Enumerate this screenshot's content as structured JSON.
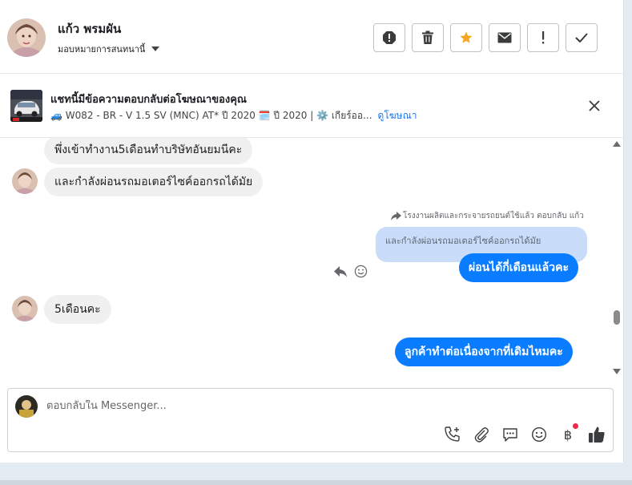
{
  "header": {
    "name": "แก้ว พรมผัน",
    "assign_label": "มอบหมายการสนทนานี้",
    "actions": [
      "spam-icon",
      "trash-icon",
      "star-icon",
      "mail-icon",
      "important-icon",
      "check-icon"
    ],
    "accent": "#f5a623"
  },
  "ad": {
    "title": "แชทนี้มีข้อความตอบกลับต่อโฆษณาของคุณ",
    "subtitle": "🚙 W082 - BR - V 1.5 SV (MNC) AT* ปี 2020 🗓️ ปี 2020 | ⚙️ เกียร์ออ...",
    "link": "ดูโฆษณา"
  },
  "chat": {
    "messages": [
      {
        "from": "customer",
        "text": "พึ่งเข้าทำงาน5เดือนทำบริษัทอันยมนีคะ"
      },
      {
        "from": "customer",
        "text": "และกำลังผ่อนรถมอเตอร์ไซค์ออกรถได้มัย"
      },
      {
        "from": "page",
        "reply_meta": "โรงงานผลิตและกระจายรถยนต์ใช้แล้ว ตอบกลับ แก้ว",
        "quote": "และกำลังผ่อนรถมอเตอร์ไซค์ออกรถได้มัย",
        "text": "ผ่อนได้กี่เดือนแล้วคะ"
      },
      {
        "from": "customer",
        "text": "5เดือนคะ"
      },
      {
        "from": "page",
        "text": "ลูกค้าทำต่อเนื่องจากที่เดิมไหมคะ"
      }
    ]
  },
  "composer": {
    "placeholder": "ตอบกลับใน Messenger...",
    "tools": [
      "call-add-icon",
      "attach-icon",
      "saved-replies-icon",
      "emoji-icon",
      "baht-icon",
      "like-icon"
    ],
    "baht_symbol": "฿"
  },
  "colors": {
    "outgoing": "#0a7cff",
    "incoming": "#f0f0f0",
    "quote": "#c9dcfa",
    "link": "#1877f2"
  }
}
